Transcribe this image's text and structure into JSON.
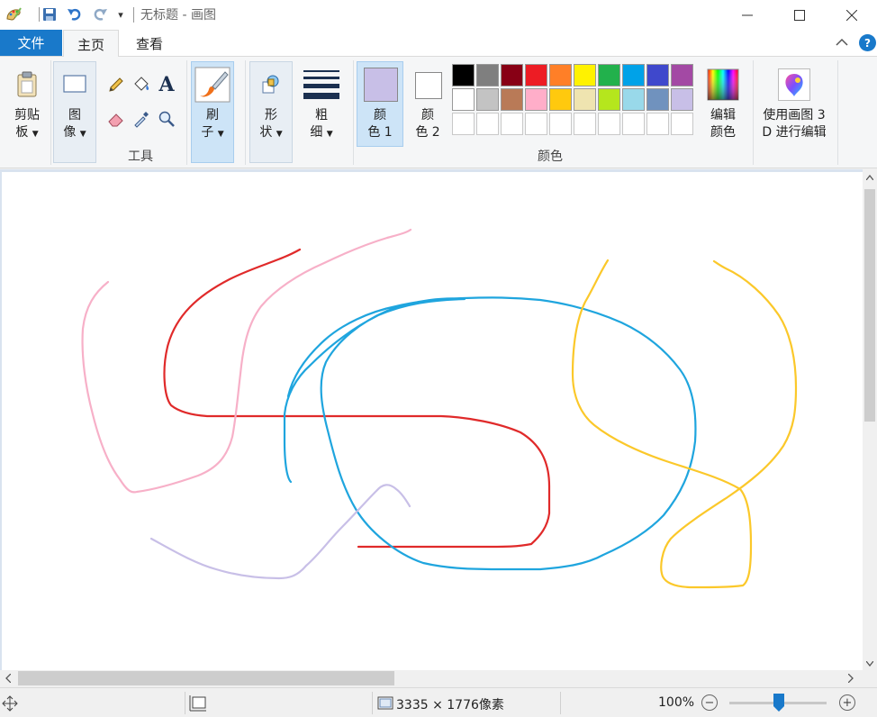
{
  "titlebar": {
    "title": "无标题 - 画图",
    "qat_more": "▾"
  },
  "tabs": {
    "file": "文件",
    "home": "主页",
    "view": "查看"
  },
  "ribbon": {
    "clipboard": {
      "label_line1": "剪贴",
      "label_line2": "板"
    },
    "image": {
      "label_line1": "图",
      "label_line2": "像"
    },
    "tools_group_label": "工具",
    "brushes": {
      "label_line1": "刷",
      "label_line2": "子"
    },
    "shapes": {
      "label_line1": "形",
      "label_line2": "状"
    },
    "size": {
      "label_line1": "粗",
      "label_line2": "细"
    },
    "color1": {
      "label_line1": "颜",
      "label_line2": "色 1",
      "color": "#c8bfe7"
    },
    "color2": {
      "label_line1": "颜",
      "label_line2": "色 2",
      "color": "#ffffff"
    },
    "colors_group_label": "颜色",
    "edit_colors": {
      "label_line1": "编辑",
      "label_line2": "颜色"
    },
    "paint3d": {
      "label_line1": "使用画图 3",
      "label_line2": "D 进行编辑"
    },
    "palette_row1": [
      "#000000",
      "#7f7f7f",
      "#880015",
      "#ed1c24",
      "#ff7f27",
      "#fff200",
      "#22b14c",
      "#00a2e8",
      "#3f48cc",
      "#a349a4"
    ],
    "palette_row2": [
      "#ffffff",
      "#c3c3c3",
      "#b97a57",
      "#ffaec9",
      "#ffc90e",
      "#efe4b0",
      "#b5e61d",
      "#99d9ea",
      "#7092be",
      "#c8bfe7"
    ]
  },
  "strokes": {
    "red": "#e02a2a",
    "pink": "#f7b0c8",
    "blue": "#1fa5de",
    "yellow": "#fbc82a",
    "lavender": "#c8bfe7"
  },
  "status": {
    "dimensions": "3335 × 1776像素",
    "zoom": "100%"
  }
}
